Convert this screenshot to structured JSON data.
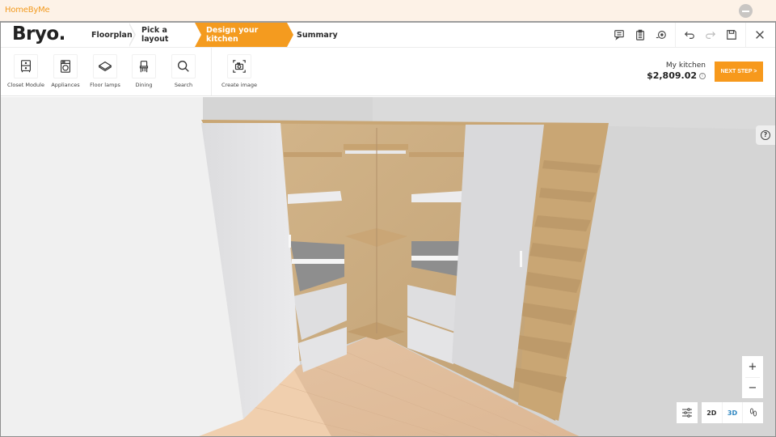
{
  "window": {
    "app_title": "HomeByMe",
    "minimize_icon": "minus-circle-icon"
  },
  "brand": {
    "logo": "Bryo."
  },
  "steps": [
    {
      "label": "Floorplan",
      "active": false
    },
    {
      "label": "Pick a layout",
      "active": false
    },
    {
      "label": "Design your kitchen",
      "active": true
    },
    {
      "label": "Summary",
      "active": false
    }
  ],
  "header_tools": [
    {
      "name": "feedback",
      "icon": "comment-icon"
    },
    {
      "name": "clipboard",
      "icon": "clipboard-icon"
    },
    {
      "name": "measure",
      "icon": "tape-measure-icon"
    },
    {
      "name": "undo",
      "icon": "undo-icon"
    },
    {
      "name": "redo",
      "icon": "redo-icon"
    },
    {
      "name": "save",
      "icon": "save-icon"
    },
    {
      "name": "close",
      "icon": "close-icon"
    }
  ],
  "toolbar": {
    "items": [
      {
        "label": "Closet Module",
        "icon": "cabinet-icon"
      },
      {
        "label": "Appliances",
        "icon": "washing-machine-icon"
      },
      {
        "label": "Floor lamps",
        "icon": "floor-tile-icon"
      },
      {
        "label": "Dining",
        "icon": "chair-icon"
      },
      {
        "label": "Search",
        "icon": "search-icon"
      },
      {
        "label": "Create image",
        "icon": "camera-icon"
      }
    ]
  },
  "summary": {
    "project_name": "My kitchen",
    "price": "$2,809.02",
    "info_icon": "info-icon",
    "next_button": "NEXT STEP >"
  },
  "viewport": {
    "help_icon": "help-icon",
    "zoom_in": "+",
    "zoom_out": "−",
    "settings_icon": "sliders-icon",
    "view_modes": [
      {
        "label": "2D",
        "active": false
      },
      {
        "label": "3D",
        "active": true
      },
      {
        "label": "walk-icon",
        "active": false
      }
    ]
  },
  "colors": {
    "accent": "#f49b1f",
    "wood": "#c8a878",
    "door": "#e6e6e8",
    "floor": "#e9c9a8",
    "wall": "#f0f0f0",
    "active_view": "#2e86c1"
  }
}
